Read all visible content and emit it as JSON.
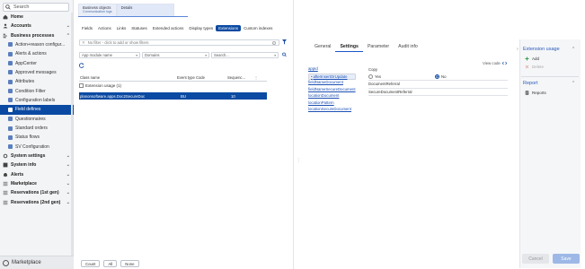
{
  "sidebar": {
    "search_label": "Search",
    "items": [
      {
        "label": "Home",
        "kind": "group",
        "icon": "home-icon"
      },
      {
        "label": "Accounts",
        "kind": "group",
        "icon": "user-icon",
        "chevron": "⌄"
      },
      {
        "label": "Business processes",
        "kind": "group",
        "icon": "process-icon",
        "chevron": "⌃"
      },
      {
        "label": "Action+reason configur...",
        "kind": "sub"
      },
      {
        "label": "Alerts & actions",
        "kind": "sub"
      },
      {
        "label": "AppCenter",
        "kind": "sub"
      },
      {
        "label": "Approved messages",
        "kind": "sub"
      },
      {
        "label": "Attributes",
        "kind": "sub"
      },
      {
        "label": "Condition Filter",
        "kind": "sub"
      },
      {
        "label": "Configuration labels",
        "kind": "sub"
      },
      {
        "label": "Field defines",
        "kind": "sub",
        "active": true
      },
      {
        "label": "Questionnaires",
        "kind": "sub"
      },
      {
        "label": "Standard orders",
        "kind": "sub"
      },
      {
        "label": "Status flows",
        "kind": "sub"
      },
      {
        "label": "SV Configuration",
        "kind": "sub"
      },
      {
        "label": "System settings",
        "kind": "group",
        "icon": "gear-icon",
        "chevron": "⌄"
      },
      {
        "label": "System info",
        "kind": "group",
        "icon": "info-icon",
        "chevron": "⌄"
      },
      {
        "label": "Alerts",
        "kind": "group",
        "icon": "bell-icon",
        "chevron": "⌄"
      },
      {
        "label": "Marketplace",
        "kind": "group",
        "icon": "grid-icon",
        "chevron": "⌄"
      },
      {
        "label": "Reservations (1st gen)",
        "kind": "group",
        "icon": "grid-icon",
        "chevron": "⌄"
      },
      {
        "label": "Reservations (2nd gen)",
        "kind": "group",
        "icon": "grid-icon",
        "chevron": "⌄"
      }
    ],
    "bottom_label": "Marketplace"
  },
  "top_tabs": [
    {
      "label": "Business objects",
      "sub": "Communication logs"
    },
    {
      "label": "Details",
      "sub": ""
    }
  ],
  "sub_tabs": [
    "Fields",
    "Actions",
    "Links",
    "Statuses",
    "Extended actions",
    "Display types",
    "Extensions",
    "Custom indexes"
  ],
  "active_sub_tab": "Extensions",
  "filter": {
    "text": "No filter - click to add or show filters"
  },
  "selects": {
    "app_module": "App module name",
    "domains": "Domains",
    "search": "Search..."
  },
  "grid": {
    "columns": [
      "Class name",
      "Event type Code",
      "Sequenc...",
      "⋮"
    ],
    "group_label": "Extension usage (1)",
    "row": {
      "class_name": "planonsoftware.apps.Doc2SecureDoc",
      "event": "BU",
      "seq": "10"
    }
  },
  "bottom_buttons": [
    "Count",
    "All",
    "None"
  ],
  "detail": {
    "tabs": [
      "General",
      "Settings",
      "Parameter",
      "Audit info"
    ],
    "active_tab": "Settings",
    "view_code": "View code",
    "attributes": [
      "appId",
      "afterInsertOrUpdate",
      "fieldNameDocument",
      "fieldNameSecureDocument",
      "locationDocument",
      "locationPattern",
      "locationSecureDocument"
    ],
    "copy_label": "Copy",
    "yes_label": "Yes",
    "no_label": "No",
    "value_1": "DocumentReferral",
    "value_2": "SecureDocumentReferral"
  },
  "right_panel": {
    "extension_usage_title": "Extension usage",
    "add_label": "Add",
    "delete_label": "Delete",
    "report_title": "Report",
    "report_item": "Reports",
    "cancel_label": "Cancel",
    "save_label": "Save"
  }
}
